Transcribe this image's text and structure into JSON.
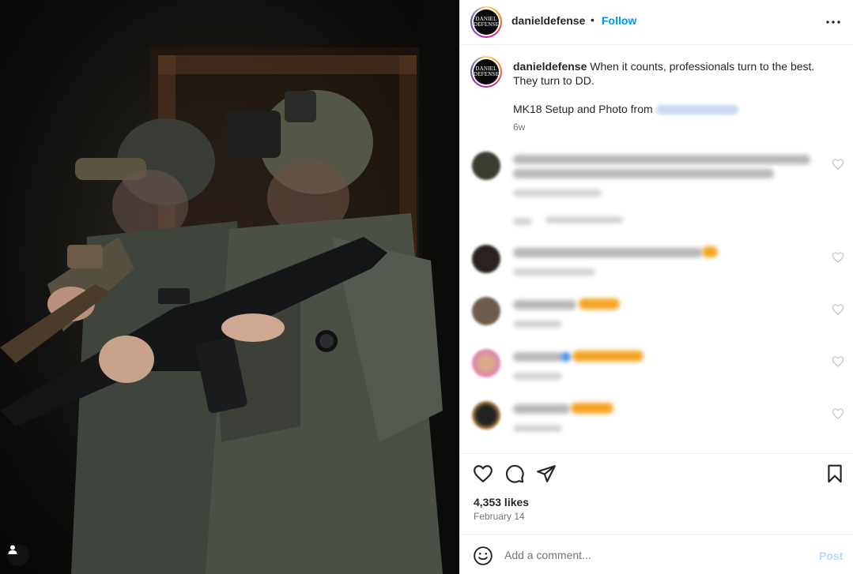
{
  "post": {
    "username": "danieldefense",
    "follow_label": "Follow",
    "separator": "•",
    "avatar_text_line1": "DANIEL",
    "avatar_text_line2": "DEFENSE"
  },
  "caption": {
    "username": "danieldefense",
    "text": "When it counts, professionals turn to the best. They turn to DD.",
    "credit_prefix": "MK18 Setup and Photo from",
    "time": "6w"
  },
  "actions": {
    "likes": "4,353 likes",
    "date": "February 14"
  },
  "comment_box": {
    "placeholder": "Add a comment...",
    "post_label": "Post"
  },
  "icons": {
    "more": "more-horizontal-icon",
    "like": "heart-icon",
    "comment": "comment-bubble-icon",
    "share": "paper-plane-icon",
    "save": "bookmark-icon",
    "emoji": "smiley-icon",
    "user_tag": "user-tag-icon"
  },
  "colors": {
    "link": "#0095f6",
    "post_disabled": "#b3dbff",
    "muted": "#737373",
    "text": "#262626"
  }
}
